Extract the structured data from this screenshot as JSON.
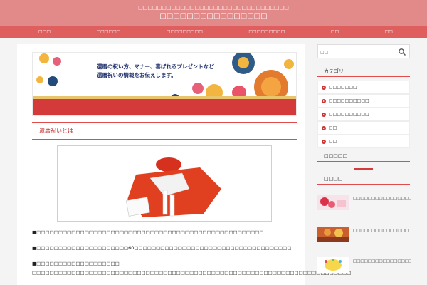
{
  "header": {
    "tagline": "□□□□□□□□□□□□□□□□□□□□□□□□□□□□□□□□",
    "site_title": "□□□□□□□□□□□□□□□□"
  },
  "nav": {
    "items": [
      {
        "label": "□□□"
      },
      {
        "label": "□□□□□□"
      },
      {
        "label": "□□□□□□□□□"
      },
      {
        "label": "□□□□□□□□□"
      },
      {
        "label": "□□"
      },
      {
        "label": "□□"
      }
    ]
  },
  "banner": {
    "line1": "還暦の祝い方、マナー、喜ばれるプレゼントなど",
    "line2": "還暦祝いの情報をお伝えします。"
  },
  "article": {
    "section_title": "還暦祝いとは",
    "para1": "■□□□□□□□□□□□□□□□□□□□□□□□□□□□□□□□□□□□□□□□□□□□□□□□□□□□□",
    "para2": "■□□□□□□□□□□□□□□□□□□□□□60□□□□□□□□□□□□□□□□□□□□□□□□□□□□□□□□□□□□",
    "para3a": "■□□□□□□□□□□□□□□□□□□□",
    "para3b": "□□□□□□□□□□□□□□□□□□□□□□□□□□□□□□□□□□□□□□□□□□□□□□□□□□□□□□□□□□□□□□□□□□□□□□□□□"
  },
  "sidebar": {
    "search": {
      "placeholder": "□□"
    },
    "category_title": "カテゴリー",
    "categories": [
      {
        "label": "□□□□□□□"
      },
      {
        "label": "□□□□□□□□□□"
      },
      {
        "label": "□□□□□□□□□□"
      },
      {
        "label": "□□"
      },
      {
        "label": "□□"
      }
    ],
    "widget2_title": "□□□□□",
    "widget3_title": "□□□□",
    "popular": [
      {
        "title": "□□□□□□□□□□□□□□□□□□□□□□□(□□□□□□)□"
      },
      {
        "title": "□□□□□□□□□□□□□□□□□□□□□□□3□□□□□□"
      },
      {
        "title": "□□□□□□□□□□□□□□□□□□□□□"
      }
    ]
  },
  "colors": {
    "header_bg": "#e28a8a",
    "nav_bg": "#df5f5f",
    "accent": "#d43a3a"
  }
}
